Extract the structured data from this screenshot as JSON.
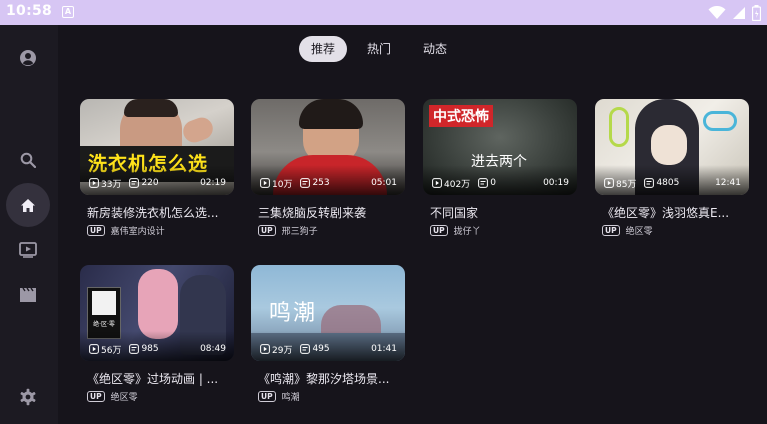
{
  "status_bar": {
    "time": "10:58",
    "notification_icon": "A"
  },
  "sidebar": {
    "items": [
      {
        "name": "avatar",
        "icon": "person-icon"
      },
      {
        "name": "search",
        "icon": "search-icon"
      },
      {
        "name": "home",
        "icon": "home-icon",
        "active": true
      },
      {
        "name": "video",
        "icon": "play-box-icon"
      },
      {
        "name": "movies",
        "icon": "clapper-icon"
      },
      {
        "name": "settings",
        "icon": "gear-icon"
      }
    ]
  },
  "tabs": [
    {
      "label": "推荐",
      "active": true
    },
    {
      "label": "热门",
      "active": false
    },
    {
      "label": "动态",
      "active": false
    }
  ],
  "videos": [
    {
      "title": "新房装修洗衣机怎么选...",
      "uploader": "嘉伟室内设计",
      "views": "33万",
      "comments": "220",
      "duration": "02:19",
      "overlay_text": "洗衣机怎么选"
    },
    {
      "title": "三集烧脑反转剧来袭",
      "uploader": "邢三狗子",
      "views": "10万",
      "comments": "253",
      "duration": "05:01",
      "overlay_text": ""
    },
    {
      "title": "不同国家",
      "uploader": "拢仔丫",
      "views": "402万",
      "comments": "0",
      "duration": "00:19",
      "overlay_text": "中式恐怖",
      "overlay_text_2": "进去两个"
    },
    {
      "title": "《绝区零》浅羽悠真E...",
      "uploader": "绝区零",
      "views": "85万",
      "comments": "4805",
      "duration": "12:41",
      "overlay_text": ""
    },
    {
      "title": "《绝区零》过场动画 | ...",
      "uploader": "绝区零",
      "views": "56万",
      "comments": "985",
      "duration": "08:49",
      "overlay_text": "绝·区·零"
    },
    {
      "title": "《鸣潮》黎那汐塔场景...",
      "uploader": "鸣潮",
      "views": "29万",
      "comments": "495",
      "duration": "01:41",
      "overlay_text": "鸣潮"
    }
  ],
  "up_badge_label": "UP",
  "colors": {
    "status_bar": "#d7c6f4",
    "background": "#16141b",
    "sidebar": "#1c1a22",
    "active_tab": "#e3e0e8"
  }
}
